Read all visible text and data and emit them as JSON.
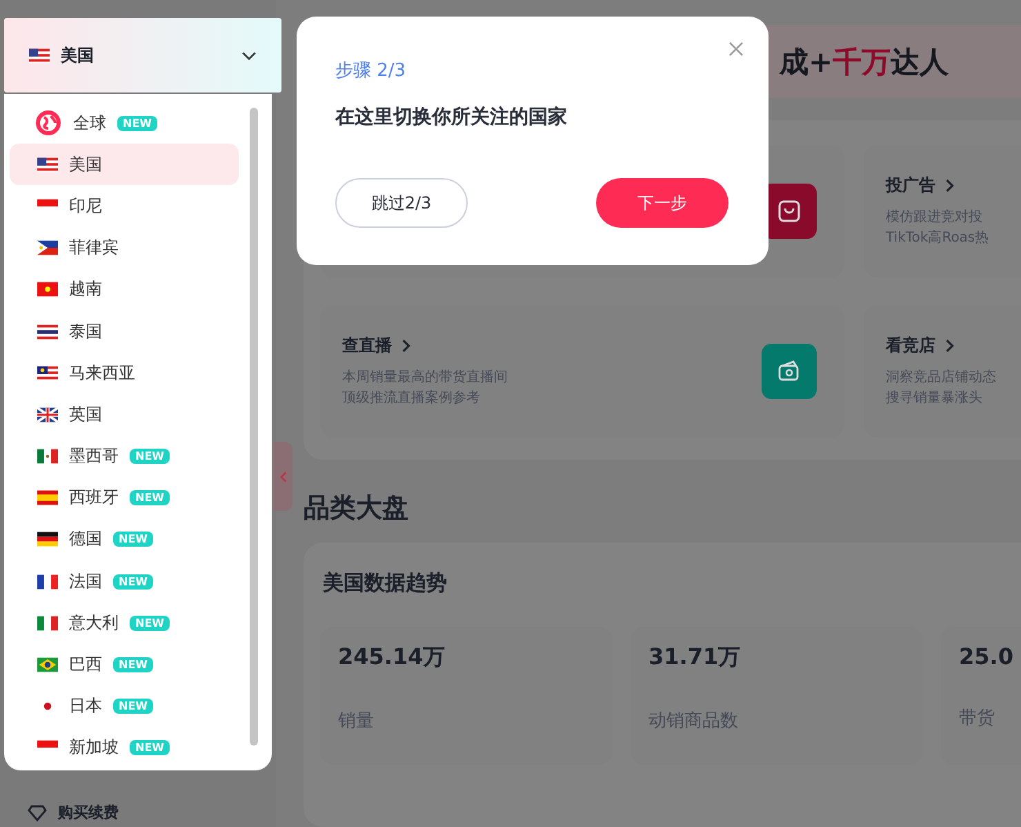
{
  "country_selector": {
    "label": "美国"
  },
  "country_menu": {
    "items": [
      {
        "label": "全球",
        "badge": "NEW",
        "selected": false
      },
      {
        "label": "美国",
        "selected": true
      },
      {
        "label": "印尼",
        "selected": false
      },
      {
        "label": "菲律宾",
        "selected": false
      },
      {
        "label": "越南",
        "selected": false
      },
      {
        "label": "泰国",
        "selected": false
      },
      {
        "label": "马来西亚",
        "selected": false
      },
      {
        "label": "英国",
        "selected": false
      },
      {
        "label": "墨西哥",
        "badge": "NEW",
        "selected": false
      },
      {
        "label": "西班牙",
        "badge": "NEW",
        "selected": false
      },
      {
        "label": "德国",
        "badge": "NEW",
        "selected": false
      },
      {
        "label": "法国",
        "badge": "NEW",
        "selected": false
      },
      {
        "label": "意大利",
        "badge": "NEW",
        "selected": false
      },
      {
        "label": "巴西",
        "badge": "NEW",
        "selected": false
      },
      {
        "label": "日本",
        "badge": "NEW",
        "selected": false
      },
      {
        "label": "新加坡",
        "badge": "NEW",
        "selected": false
      }
    ]
  },
  "sidebar_footer": {
    "label": "购买续费"
  },
  "guide_popover": {
    "step": "步骤 2/3",
    "message": "在这里切换你所关注的国家",
    "skip_button": "跳过2/3",
    "next_button": "下一步"
  },
  "banner": {
    "parts": [
      {
        "text": "成+",
        "highlight": false
      },
      {
        "text": "千万",
        "highlight": true
      },
      {
        "text": "达人",
        "highlight": false
      }
    ]
  },
  "feature_cards": [
    {
      "color": "#8a0a2c"
    },
    {
      "title": "投广告",
      "lines": [
        "模仿跟进竞对投",
        "TikTok高Roas热"
      ]
    },
    {
      "title": "查直播",
      "lines": [
        "本周销量最高的带货直播间",
        "顶级推流直播案例参考"
      ],
      "color": "#047a6c"
    },
    {
      "title": "看竞店",
      "lines": [
        "洞察竞品店铺动态",
        "搜寻销量暴涨头"
      ]
    }
  ],
  "category_section": {
    "heading": "品类大盘",
    "panel_title": "美国数据趋势",
    "stats": [
      {
        "value": "245.14万",
        "label": "销量"
      },
      {
        "value": "31.71万",
        "label": "动销商品数"
      },
      {
        "value": "25.0",
        "label": "带货"
      }
    ]
  }
}
